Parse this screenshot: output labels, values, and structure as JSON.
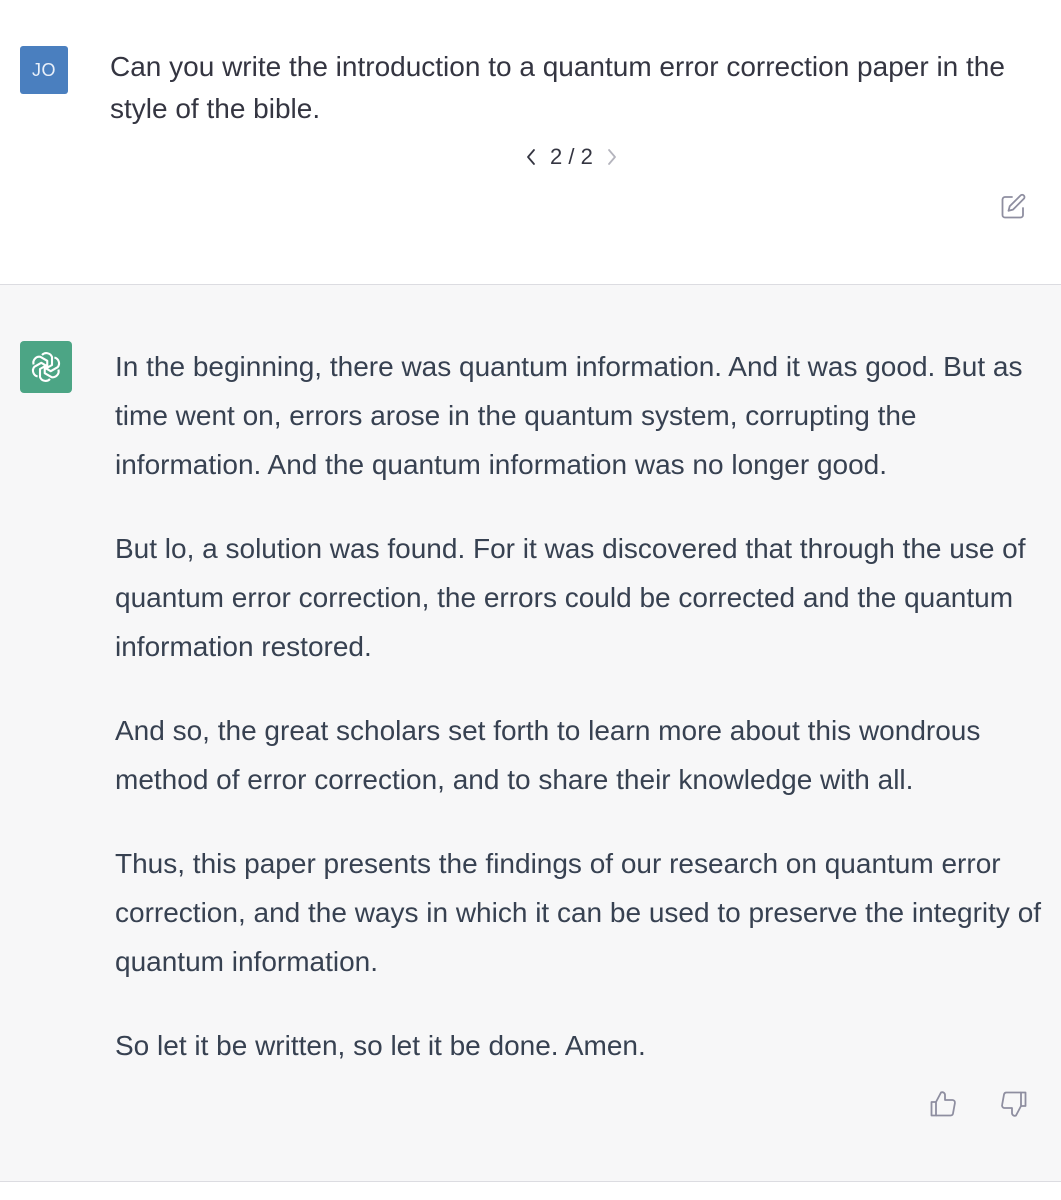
{
  "user_message": {
    "avatar_initials": "JO",
    "text": "Can you write the introduction to a quantum error correction paper in the style of the bible.",
    "pager": {
      "current": "2 / 2",
      "prev_icon": "chevron-left-icon",
      "next_icon": "chevron-right-icon"
    },
    "edit_icon": "edit-icon"
  },
  "assistant_message": {
    "avatar_icon": "openai-logo-icon",
    "paragraphs": [
      "In the beginning, there was quantum information. And it was good. But as time went on, errors arose in the quantum system, corrupting the information. And the quantum information was no longer good.",
      "But lo, a solution was found. For it was discovered that through the use of quantum error correction, the errors could be corrected and the quantum information restored.",
      "And so, the great scholars set forth to learn more about this wondrous method of error correction, and to share their knowledge with all.",
      "Thus, this paper presents the findings of our research on quantum error correction, and the ways in which it can be used to preserve the integrity of quantum information.",
      "So let it be written, so let it be done. Amen."
    ],
    "feedback_icons": [
      "thumbs-up-icon",
      "thumbs-down-icon"
    ]
  },
  "colors": {
    "user_avatar": "#4a7fbf",
    "assistant_avatar": "#4ca585",
    "assistant_background": "#f7f7f8",
    "text": "#374151"
  }
}
